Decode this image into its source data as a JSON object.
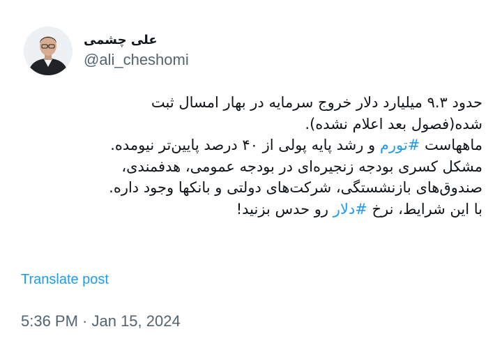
{
  "author": {
    "display_name": "علی چشمی",
    "handle": "@ali_cheshomi"
  },
  "post": {
    "lines": [
      [
        {
          "text": "حدود ۹.۳ میلیارد دلار خروج سرمایه در بهار امسال ثبت"
        }
      ],
      [
        {
          "text": "شده(فصول بعد اعلام نشده)."
        }
      ],
      [
        {
          "text": "ماههاست "
        },
        {
          "text": "#تورم",
          "tag": true
        },
        {
          "text": " و رشد پایه پولی از ۴۰ درصد پایین‌تر نیومده."
        }
      ],
      [
        {
          "text": "مشکل کسری بودجه زنجیره‌ای در بودجه عمومی، هدفمندی،"
        }
      ],
      [
        {
          "text": "صندوق‌های بازنشستگی، شرکت‌های دولتی و بانکها وجود داره."
        }
      ],
      [
        {
          "text": "با این شرایط، نرخ "
        },
        {
          "text": "#دلار",
          "tag": true
        },
        {
          "text": " رو حدس بزنید!"
        }
      ]
    ]
  },
  "actions": {
    "translate_label": "Translate post"
  },
  "meta": {
    "timestamp": "5:36 PM · Jan 15, 2024"
  },
  "colors": {
    "hashtag": "#1d9bf0",
    "secondary_text": "#536471",
    "primary_text": "#0f1419"
  }
}
